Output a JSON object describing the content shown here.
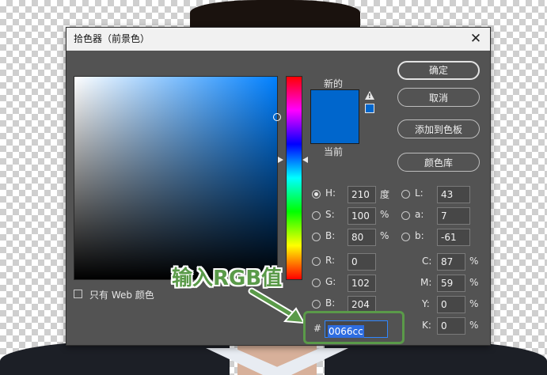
{
  "dialog": {
    "title": "拾色器（前景色）",
    "close_glyph": "✕"
  },
  "swatch": {
    "new_label": "新的",
    "current_label": "当前",
    "color": "#0066cc",
    "warning_glyph": "!"
  },
  "buttons": {
    "ok": "确定",
    "cancel": "取消",
    "add_to_swatches": "添加到色板",
    "color_libraries": "颜色库"
  },
  "hsb": {
    "h_label": "H:",
    "h_value": "210",
    "h_unit": "度",
    "s_label": "S:",
    "s_value": "100",
    "s_unit": "%",
    "b_label": "B:",
    "b_value": "80",
    "b_unit": "%"
  },
  "lab": {
    "l_label": "L:",
    "l_value": "43",
    "a_label": "a:",
    "a_value": "7",
    "b_label": "b:",
    "b_value": "-61"
  },
  "rgb": {
    "r_label": "R:",
    "r_value": "0",
    "g_label": "G:",
    "g_value": "102",
    "b_label": "B:",
    "b_value": "204"
  },
  "cmyk": {
    "c_label": "C:",
    "c_value": "87",
    "c_unit": "%",
    "m_label": "M:",
    "m_value": "59",
    "m_unit": "%",
    "y_label": "Y:",
    "y_value": "0",
    "y_unit": "%",
    "k_label": "K:",
    "k_value": "0",
    "k_unit": "%"
  },
  "hex": {
    "label": "#",
    "value": "0066cc"
  },
  "web_only_label": "只有 Web 颜色",
  "annotation": {
    "callout_text": "输入RGB值",
    "accent_color": "#5a9a49"
  }
}
